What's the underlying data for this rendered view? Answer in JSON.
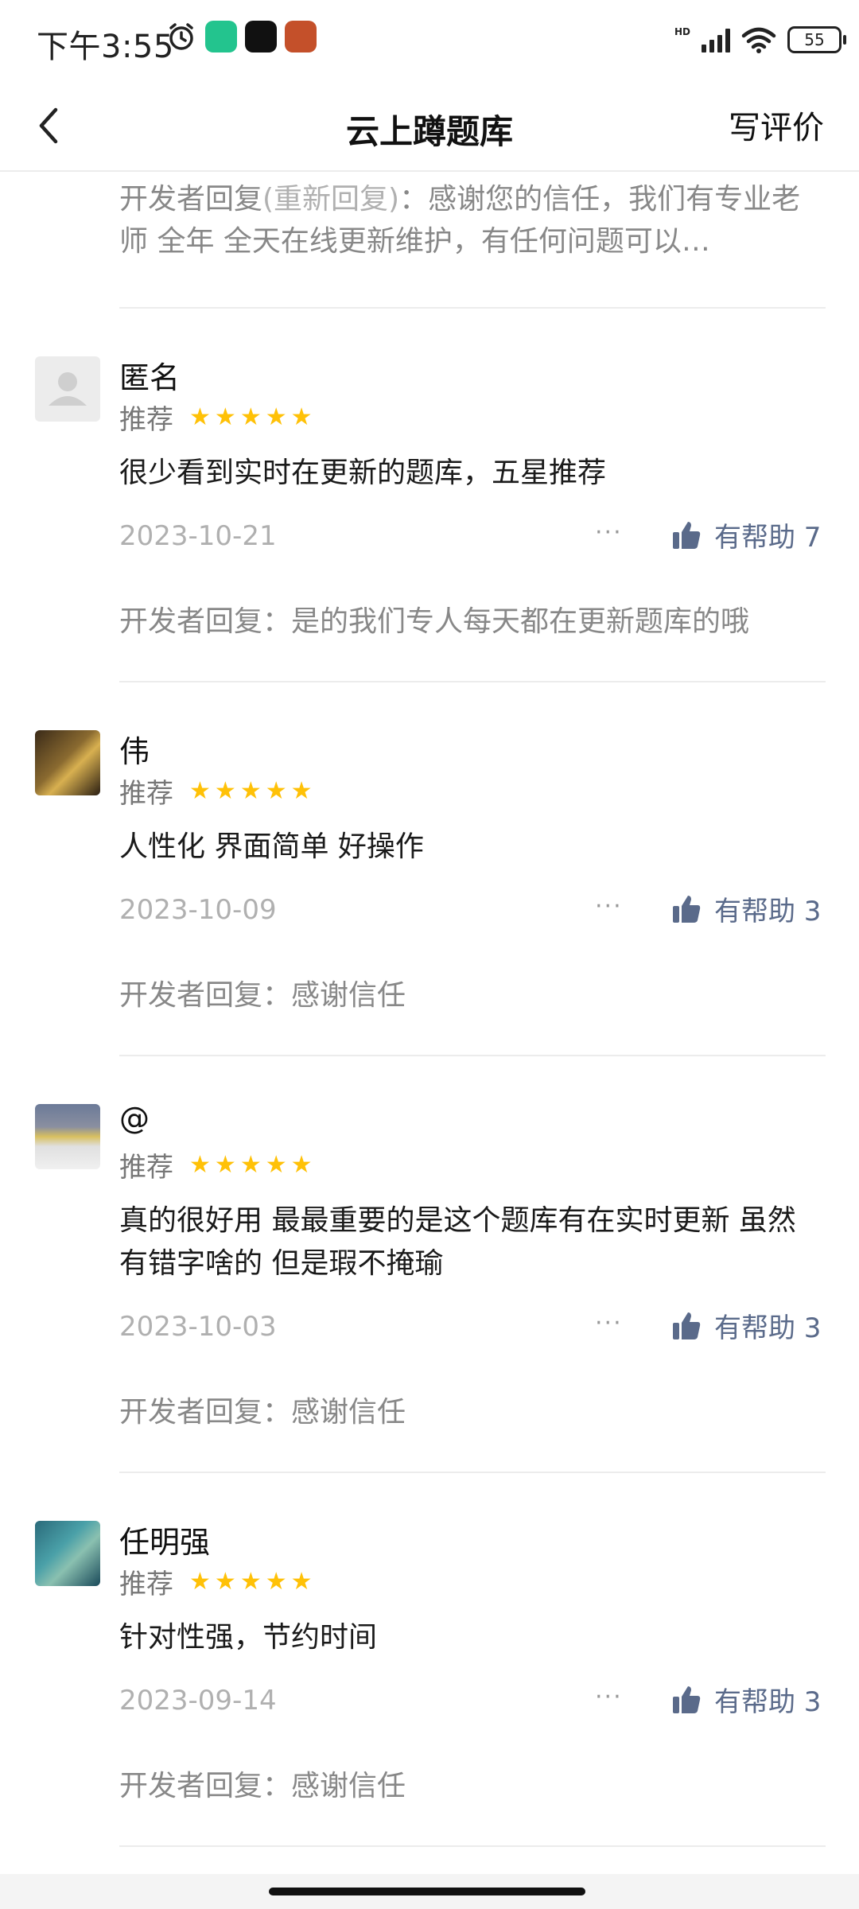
{
  "status_bar": {
    "time": "下午3:55",
    "hd": "HD",
    "battery": "55"
  },
  "header": {
    "title": "云上蹲题库",
    "write_review": "写评价"
  },
  "top_reply": {
    "prefix": "开发者回复",
    "reanswer": "(重新回复)",
    "text": "：感谢您的信任，我们有专业老师 全年 全天在线更新维护，有任何问题可以…"
  },
  "reviews": [
    {
      "name": "匿名",
      "recommend": "推荐",
      "stars": 5,
      "content": "很少看到实时在更新的题库，五星推荐",
      "date": "2023-10-21",
      "more": "···",
      "helpful": "有帮助 7",
      "dev_reply": "开发者回复：是的我们专人每天都在更新题库的哦"
    },
    {
      "name": "伟",
      "recommend": "推荐",
      "stars": 5,
      "content": "人性化 界面简单 好操作",
      "date": "2023-10-09",
      "more": "···",
      "helpful": "有帮助 3",
      "dev_reply": "开发者回复：感谢信任"
    },
    {
      "name": "@",
      "recommend": "推荐",
      "stars": 5,
      "content": "真的很好用 最最重要的是这个题库有在实时更新 虽然有错字啥的 但是瑕不掩瑜",
      "date": "2023-10-03",
      "more": "···",
      "helpful": "有帮助 3",
      "dev_reply": "开发者回复：感谢信任"
    },
    {
      "name": "任明强",
      "recommend": "推荐",
      "stars": 5,
      "content": "针对性强，节约时间",
      "date": "2023-09-14",
      "more": "···",
      "helpful": "有帮助 3",
      "dev_reply": "开发者回复：感谢信任"
    }
  ],
  "colors": {
    "star": "#ffc107",
    "helpful": "#5a6a8a",
    "muted": "#b0b0b0"
  }
}
